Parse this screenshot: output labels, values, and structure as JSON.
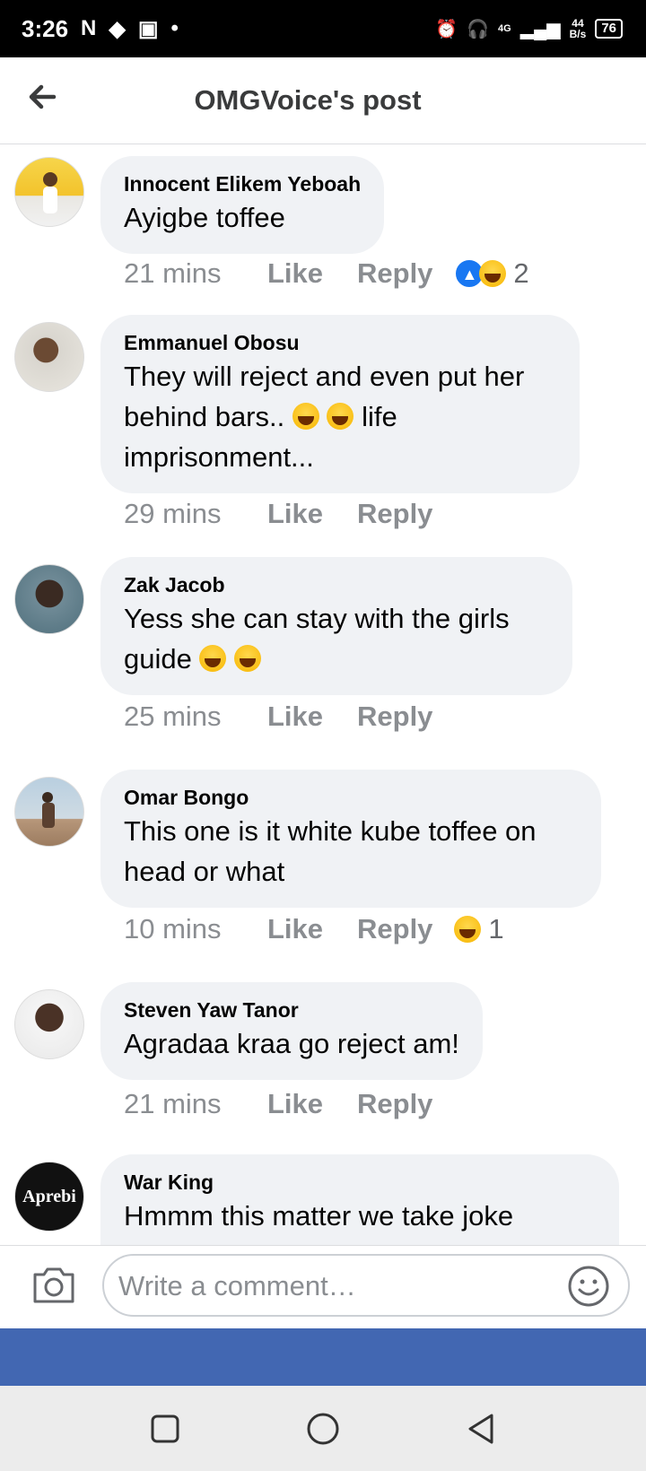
{
  "status_bar": {
    "time": "3:26",
    "speed_top": "44",
    "speed_bottom": "B/s",
    "network": "4G",
    "battery": "76"
  },
  "header": {
    "title": "OMGVoice's post"
  },
  "comments": [
    {
      "author": "Innocent Elikem Yeboah",
      "text": "Ayigbe toffee",
      "time": "21 mins",
      "like": "Like",
      "reply": "Reply",
      "reaction_count": "2"
    },
    {
      "author": "Emmanuel Obosu",
      "text_line1": "They will reject and even put her",
      "text_line2": "behind bars..",
      "text_line2_tail": "life",
      "text_line3": "imprisonment...",
      "time": "29 mins",
      "like": "Like",
      "reply": "Reply"
    },
    {
      "author": "Zak Jacob",
      "text_line1": "Yess she can stay with the girls",
      "text_line2": "guide",
      "time": "25 mins",
      "like": "Like",
      "reply": "Reply"
    },
    {
      "author": "Omar Bongo",
      "text_line1": "This one is it white kube toffee on",
      "text_line2": "head or what",
      "time": "10 mins",
      "like": "Like",
      "reply": "Reply",
      "reaction_count": "1"
    },
    {
      "author": "Steven Yaw Tanor",
      "text": "Agradaa kraa go reject am!",
      "time": "21 mins",
      "like": "Like",
      "reply": "Reply"
    },
    {
      "author": "War King",
      "text": "Hmmm this matter we take joke",
      "avatar_text": "Aprebi"
    }
  ],
  "composer": {
    "placeholder": "Write a comment…"
  },
  "icons": {
    "back": "arrow-left-icon",
    "camera": "camera-icon",
    "emoji": "smiley-icon"
  },
  "colors": {
    "bubble": "#f0f2f5",
    "accent_band": "#4267b2",
    "meta_text": "#8a8d91"
  }
}
